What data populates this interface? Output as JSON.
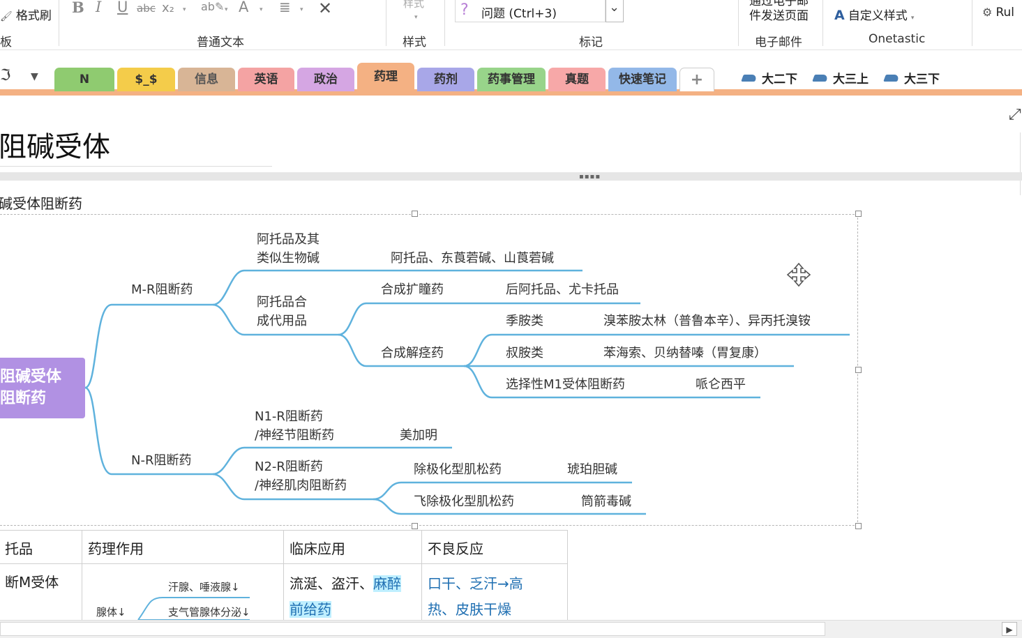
{
  "ribbon": {
    "format_painter": "格式刷",
    "clipboard_label": "板",
    "normal_text_label": "普通文本",
    "styles_top": "样式",
    "styles_label": "样式",
    "tag_value": "问题 (Ctrl+3)",
    "tags_label": "标记",
    "email_line1": "通过电子邮",
    "email_line2": "件发送页面",
    "email_label": "电子邮件",
    "custom_style": "自定义样式",
    "onetastic_label": "Onetastic",
    "rules_cut": "Rul",
    "fmt_icons": [
      "bold-icon",
      "italic-icon",
      "underline-icon",
      "strikethrough-icon",
      "subscript-icon",
      "highlight-icon",
      "font-color-icon",
      "align-icon",
      "clear-format-icon"
    ]
  },
  "tabs": [
    {
      "label": "N",
      "color": "#8fcb70"
    },
    {
      "label": "$_$",
      "color": "#f4cc4a"
    },
    {
      "label": "信息",
      "color": "#d8b596"
    },
    {
      "label": "英语",
      "color": "#f4a3a3"
    },
    {
      "label": "政治",
      "color": "#d5a6e3"
    },
    {
      "label": "药理",
      "color": "#f4b183"
    },
    {
      "label": "药剂",
      "color": "#a8a7e8"
    },
    {
      "label": "药事管理",
      "color": "#98d48a"
    },
    {
      "label": "真题",
      "color": "#f7a8a8"
    },
    {
      "label": "快速笔记",
      "color": "#93b8e8"
    },
    {
      "label": "+",
      "color": "#ffffff"
    }
  ],
  "notebooks": [
    "大二下",
    "大三上",
    "大三下"
  ],
  "page": {
    "title": "阻碱受体",
    "heading": "碱受体阻断药"
  },
  "mindmap": {
    "root": [
      "阻碱受体",
      "阻断药"
    ],
    "mr": "M-R阻断药",
    "atropine_group": [
      "阿托品及其",
      "类似生物碱"
    ],
    "atropine_items": "阿托品、东莨菪碱、山莨菪碱",
    "synthetic_group": [
      "阿托品合",
      "成代用品"
    ],
    "mydriatic": "合成扩瞳药",
    "mydriatic_items": "后阿托品、尤卡托品",
    "antispasmodic": "合成解痉药",
    "quaternary": "季胺类",
    "quaternary_items": "溴苯胺太林（普鲁本辛）、异丙托溴铵",
    "tertiary": "叔胺类",
    "tertiary_items": "苯海索、贝纳替嗪（胃复康）",
    "selective": "选择性M1受体阻断药",
    "selective_items": "哌仑西平",
    "nr": "N-R阻断药",
    "n1": [
      "N1-R阻断药",
      "/神经节阻断药"
    ],
    "n1_items": "美加明",
    "n2": [
      "N2-R阻断药",
      "/神经肌肉阻断药"
    ],
    "depol": "除极化型肌松药",
    "depol_items": "琥珀胆碱",
    "nondepol": "飞除极化型肌松药",
    "nondepol_items": "筒箭毒碱"
  },
  "table": {
    "headers": [
      "托品",
      "药理作用",
      "临床应用",
      "不良反应"
    ],
    "row1_col1": "断M受体",
    "glands": "腺体↓",
    "sweat": "汗腺、唾液腺↓",
    "bronchial": "支气管腺体分泌↓",
    "clinical_plain": "流涎、盗汗、",
    "clinical_hl1": "麻醉",
    "clinical_hl2": "前给药",
    "adverse_line1": "口干、乏汗→高",
    "adverse_line2": "热、皮肤干燥"
  }
}
